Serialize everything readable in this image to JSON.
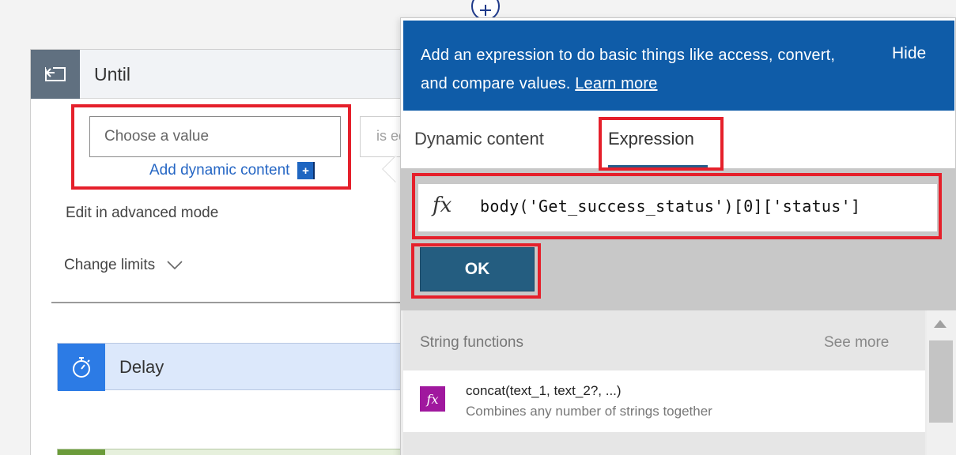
{
  "until": {
    "title": "Until",
    "value_placeholder": "Choose a value",
    "operator_text": "is equal to",
    "add_dynamic_label": "Add dynamic content",
    "add_dynamic_plus": "+",
    "edit_advanced_label": "Edit in advanced mode",
    "change_limits_label": "Change limits"
  },
  "delay": {
    "title": "Delay"
  },
  "panel": {
    "info_text": "Add an expression to do basic things like access, convert, and compare values.",
    "learn_more": "Learn more",
    "hide_label": "Hide",
    "tabs": [
      {
        "label": "Dynamic content",
        "active": false
      },
      {
        "label": "Expression",
        "active": true
      }
    ],
    "fx_symbol": "fx",
    "expression_value": "body('Get_success_status')[0]['status']",
    "ok_label": "OK",
    "functions": {
      "category": "String functions",
      "see_more": "See more",
      "items": [
        {
          "name": "concat(text_1, text_2?, ...)",
          "description": "Combines any number of strings together",
          "icon": "fx-icon"
        }
      ]
    }
  },
  "colors": {
    "info_bar": "#0f5ca8",
    "ok_button": "#245d80",
    "highlight": "#e5202b",
    "function_icon": "#a0189e",
    "delay_accent": "#2c7be5"
  }
}
